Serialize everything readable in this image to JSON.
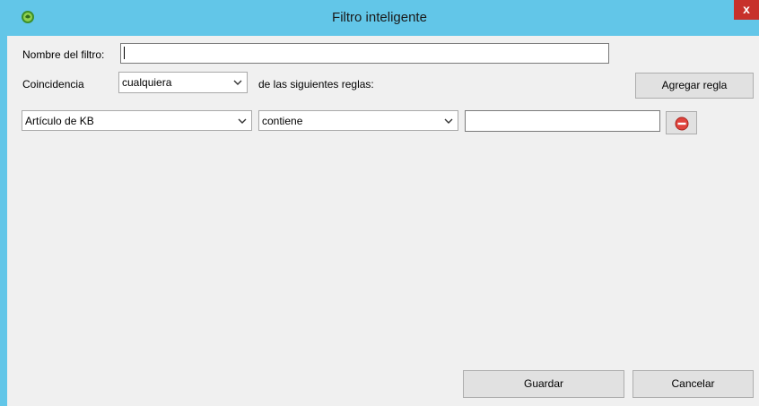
{
  "window": {
    "title": "Filtro inteligente",
    "close_glyph": "x",
    "app_icon": "globe-leaf-icon"
  },
  "form": {
    "name_label": "Nombre del filtro:",
    "name_value": "",
    "match_label": "Coincidencia",
    "match_value": "cualquiera",
    "rules_suffix": "de las siguientes reglas:",
    "add_rule_label": "Agregar regla"
  },
  "rules": [
    {
      "field": "Artículo de KB",
      "operator": "contiene",
      "value": "",
      "remove_icon": "remove-icon"
    }
  ],
  "footer": {
    "save_label": "Guardar",
    "cancel_label": "Cancelar"
  },
  "colors": {
    "frame": "#62c6e8",
    "close": "#c7312b",
    "client_bg": "#f0f0f0",
    "remove_icon": "#e0433c"
  }
}
